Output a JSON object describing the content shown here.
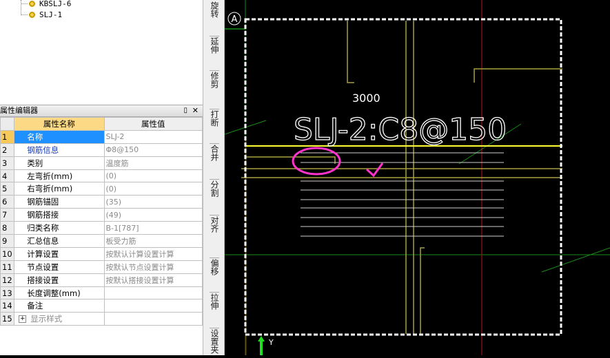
{
  "tree": {
    "items": [
      "KBSLJ-6",
      "SLJ-1"
    ]
  },
  "property_panel": {
    "title": "属性编辑器",
    "pin_icon": "pin-icon",
    "close_icon": "close-icon",
    "columns": [
      "属性名称",
      "属性值"
    ],
    "rows": [
      {
        "num": "1",
        "name": "名称",
        "value": "SLJ-2"
      },
      {
        "num": "2",
        "name": "钢筋信息",
        "value": "Φ8@150"
      },
      {
        "num": "3",
        "name": "类别",
        "value": "温度筋"
      },
      {
        "num": "4",
        "name": "左弯折(mm)",
        "value": "(0)"
      },
      {
        "num": "5",
        "name": "右弯折(mm)",
        "value": "(0)"
      },
      {
        "num": "6",
        "name": "钢筋锚固",
        "value": "(35)"
      },
      {
        "num": "7",
        "name": "钢筋搭接",
        "value": "(49)"
      },
      {
        "num": "8",
        "name": "归类名称",
        "value": "B-1[787]"
      },
      {
        "num": "9",
        "name": "汇总信息",
        "value": "板受力筋"
      },
      {
        "num": "10",
        "name": "计算设置",
        "value": "按默认计算设置计算"
      },
      {
        "num": "11",
        "name": "节点设置",
        "value": "按默认节点设置计算"
      },
      {
        "num": "12",
        "name": "搭接设置",
        "value": "按默认搭接设置计算"
      },
      {
        "num": "13",
        "name": "长度调整(mm)",
        "value": ""
      },
      {
        "num": "14",
        "name": "备注",
        "value": ""
      },
      {
        "num": "15",
        "name": "显示样式",
        "value": ""
      }
    ]
  },
  "toolbar": {
    "items": [
      {
        "label": "旋转",
        "icon": "rotate-icon"
      },
      {
        "label": "延伸",
        "icon": "extend-icon"
      },
      {
        "label": "修剪",
        "icon": "trim-icon"
      },
      {
        "label": "打断",
        "icon": "break-icon"
      },
      {
        "label": "合并",
        "icon": "merge-icon"
      },
      {
        "label": "分割",
        "icon": "split-icon"
      },
      {
        "label": "对齐",
        "icon": "align-icon"
      },
      {
        "label": "偏移",
        "icon": "offset-icon"
      },
      {
        "label": "拉伸",
        "icon": "stretch-icon"
      },
      {
        "label": "设置夹",
        "icon": "grip-icon"
      }
    ]
  },
  "canvas": {
    "axis_label": "A",
    "rebar_label": "SLJ-2:C8@150",
    "dimension": "3000",
    "y_axis": "Y",
    "colors": {
      "background": "#000000",
      "rebar_yellow": "#ffff33",
      "line_olive": "#a8a040",
      "grid_green": "#1a8c1a",
      "grid_red": "#b01818",
      "annotation_magenta": "#ff33cc",
      "selection_white": "#ffffff"
    }
  }
}
